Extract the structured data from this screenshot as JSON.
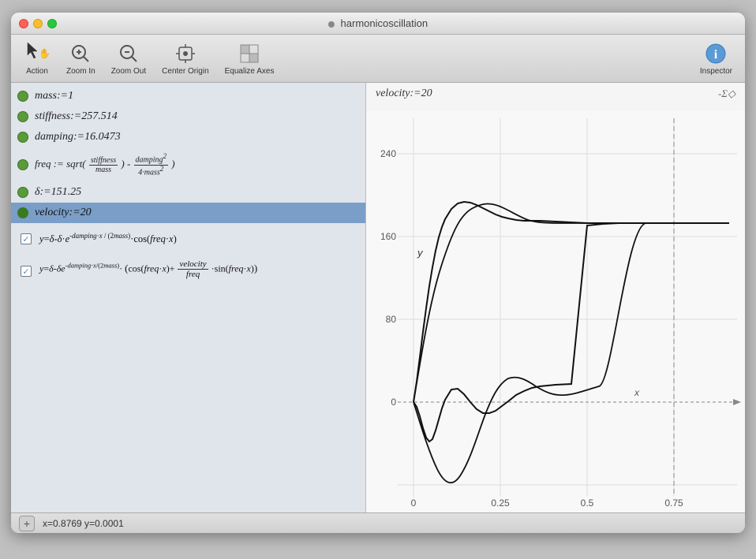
{
  "window": {
    "title": "harmonicoscillation",
    "title_dot": "●"
  },
  "toolbar": {
    "action_label": "Action",
    "zoom_in_label": "Zoom In",
    "zoom_out_label": "Zoom Out",
    "center_origin_label": "Center Origin",
    "equalize_axes_label": "Equalize Axes",
    "inspector_label": "Inspector"
  },
  "params": [
    {
      "id": "mass",
      "text": "mass:=1",
      "selected": false
    },
    {
      "id": "stiffness",
      "text": "stiffness:=257.514",
      "selected": false
    },
    {
      "id": "damping",
      "text": "damping:=16.0473",
      "selected": false
    },
    {
      "id": "freq",
      "text": "freq := sqrt((stiffness/mass) - damping²/(4·mass²))",
      "selected": false
    },
    {
      "id": "delta",
      "text": "δ:=151.25",
      "selected": false
    },
    {
      "id": "velocity",
      "text": "velocity:=20",
      "selected": true
    }
  ],
  "formulas": [
    {
      "id": "formula1",
      "checked": true,
      "text": "y=δ-δ·e^(-damping·x/(2mass))·cos(freq·x)"
    },
    {
      "id": "formula2",
      "checked": true,
      "text": "y=δ-δe^(-damping·x/(2mass))·(cos(freq·x)+velocity/freq·sin(freq·x))"
    }
  ],
  "graph": {
    "velocity_label": "velocity:=20",
    "sigma_symbol": "-Σ◇",
    "x_coord": "x=0.8769",
    "y_coord": "y=0.0001",
    "y_axis_labels": [
      "240",
      "160",
      "80",
      "0"
    ],
    "x_axis_labels": [
      "0",
      "0.25",
      "0.5",
      "x",
      "0.75"
    ],
    "dashed_line_x": 0.75
  },
  "statusbar": {
    "add_label": "+",
    "coords": "x=0.8769  y=0.0001"
  }
}
